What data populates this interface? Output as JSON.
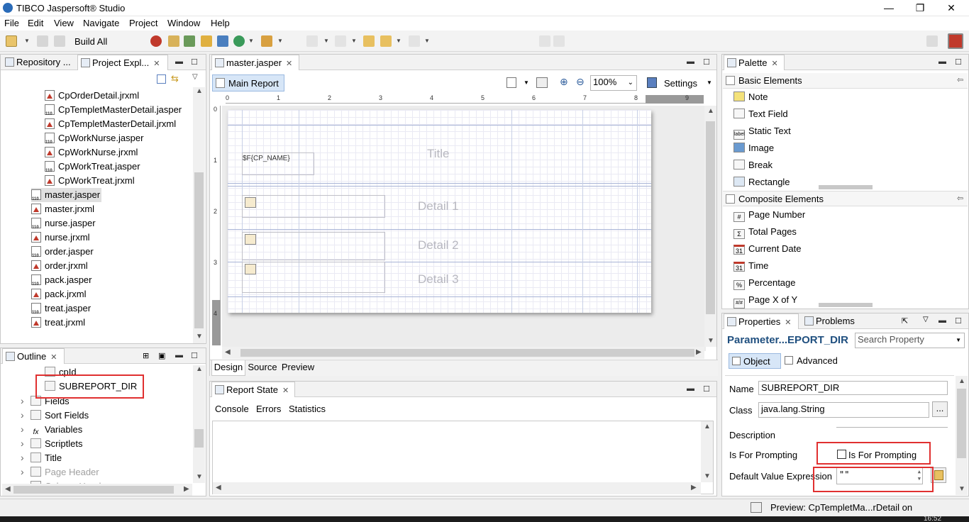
{
  "window": {
    "title": "TIBCO Jaspersoft® Studio",
    "min": "—",
    "max": "❐",
    "close": "✕"
  },
  "menu": [
    "File",
    "Edit",
    "View",
    "Navigate",
    "Project",
    "Window",
    "Help"
  ],
  "toolbar": {
    "build_all": "Build All"
  },
  "left_tabs": {
    "repository": "Repository ...",
    "project_explorer": "Project Expl..."
  },
  "files": [
    {
      "name": "CpOrderDetail.jrxml",
      "type": "jr"
    },
    {
      "name": "CpTempletMasterDetail.jasper",
      "type": "js"
    },
    {
      "name": "CpTempletMasterDetail.jrxml",
      "type": "jr"
    },
    {
      "name": "CpWorkNurse.jasper",
      "type": "js"
    },
    {
      "name": "CpWorkNurse.jrxml",
      "type": "jr"
    },
    {
      "name": "CpWorkTreat.jasper",
      "type": "js"
    },
    {
      "name": "CpWorkTreat.jrxml",
      "type": "jr"
    },
    {
      "name": "master.jasper",
      "type": "js"
    },
    {
      "name": "master.jrxml",
      "type": "jr"
    },
    {
      "name": "nurse.jasper",
      "type": "js"
    },
    {
      "name": "nurse.jrxml",
      "type": "jr"
    },
    {
      "name": "order.jasper",
      "type": "js"
    },
    {
      "name": "order.jrxml",
      "type": "jr"
    },
    {
      "name": "pack.jasper",
      "type": "js"
    },
    {
      "name": "pack.jrxml",
      "type": "jr"
    },
    {
      "name": "treat.jasper",
      "type": "js"
    },
    {
      "name": "treat.jrxml",
      "type": "jr"
    }
  ],
  "selected_file": "master.jasper",
  "outline": {
    "tab": "Outline",
    "items": [
      {
        "label": "cpId",
        "icon": "parameter-icon"
      },
      {
        "label": "SUBREPORT_DIR",
        "icon": "parameter-icon"
      },
      {
        "label": "Fields",
        "icon": "fields-icon"
      },
      {
        "label": "Sort Fields",
        "icon": "sort-fields-icon"
      },
      {
        "label": "Variables",
        "icon": "fx-icon"
      },
      {
        "label": "Scriptlets",
        "icon": "scriptlets-icon"
      },
      {
        "label": "Title",
        "icon": "band-icon"
      },
      {
        "label": "Page Header",
        "icon": "band-icon"
      },
      {
        "label": "Column Header",
        "icon": "band-icon"
      }
    ]
  },
  "editor": {
    "tab": "master.jasper",
    "main_report": "Main Report",
    "zoom": "100%",
    "settings": "Settings",
    "ruler": [
      "0",
      "1",
      "2",
      "3",
      "4",
      "5",
      "6",
      "7",
      "8",
      "9"
    ],
    "vruler": [
      "0",
      "1",
      "2",
      "3",
      "4"
    ],
    "field_expr": "$F{CP_NAME}",
    "bands": [
      "Title",
      "Detail 1",
      "Detail 2",
      "Detail 3"
    ],
    "bottom_tabs": [
      "Design",
      "Source",
      "Preview"
    ],
    "active_bottom_tab": "Design"
  },
  "report_state": {
    "tab": "Report State",
    "tabs": [
      "Console",
      "Errors",
      "Statistics"
    ]
  },
  "palette": {
    "tab": "Palette",
    "basic_header": "Basic Elements",
    "basic": [
      {
        "label": "Note",
        "icon": "note-icon"
      },
      {
        "label": "Text Field",
        "icon": "text-field-icon"
      },
      {
        "label": "Static Text",
        "icon": "static-text-icon",
        "glyph": "label"
      },
      {
        "label": "Image",
        "icon": "image-icon"
      },
      {
        "label": "Break",
        "icon": "break-icon"
      },
      {
        "label": "Rectangle",
        "icon": "rectangle-icon"
      }
    ],
    "composite_header": "Composite Elements",
    "composite": [
      {
        "label": "Page Number",
        "icon": "page-number-icon",
        "glyph": "#"
      },
      {
        "label": "Total Pages",
        "icon": "total-pages-icon",
        "glyph": "Σ"
      },
      {
        "label": "Current Date",
        "icon": "calendar-icon",
        "glyph": "31"
      },
      {
        "label": "Time",
        "icon": "calendar-icon",
        "glyph": "31"
      },
      {
        "label": "Percentage",
        "icon": "percentage-icon",
        "glyph": "%"
      },
      {
        "label": "Page X of Y",
        "icon": "page-x-of-y-icon",
        "glyph": "#/#"
      }
    ]
  },
  "properties": {
    "tab": "Properties",
    "problems_tab": "Problems",
    "title": "Parameter...EPORT_DIR",
    "search_placeholder": "Search Property",
    "subtabs": [
      "Object",
      "Advanced"
    ],
    "name_label": "Name",
    "name_value": "SUBREPORT_DIR",
    "class_label": "Class",
    "class_value": "java.lang.String",
    "class_btn": "...",
    "description_label": "Description",
    "description_value": "",
    "prompting_label": "Is For Prompting",
    "prompting_checkbox_label": "Is For Prompting",
    "prompting_checked": false,
    "default_label": "Default Value Expression",
    "default_value": "\"\""
  },
  "status": {
    "text": "Preview: CpTempletMa...rDetail on",
    "clock": "16:52"
  }
}
